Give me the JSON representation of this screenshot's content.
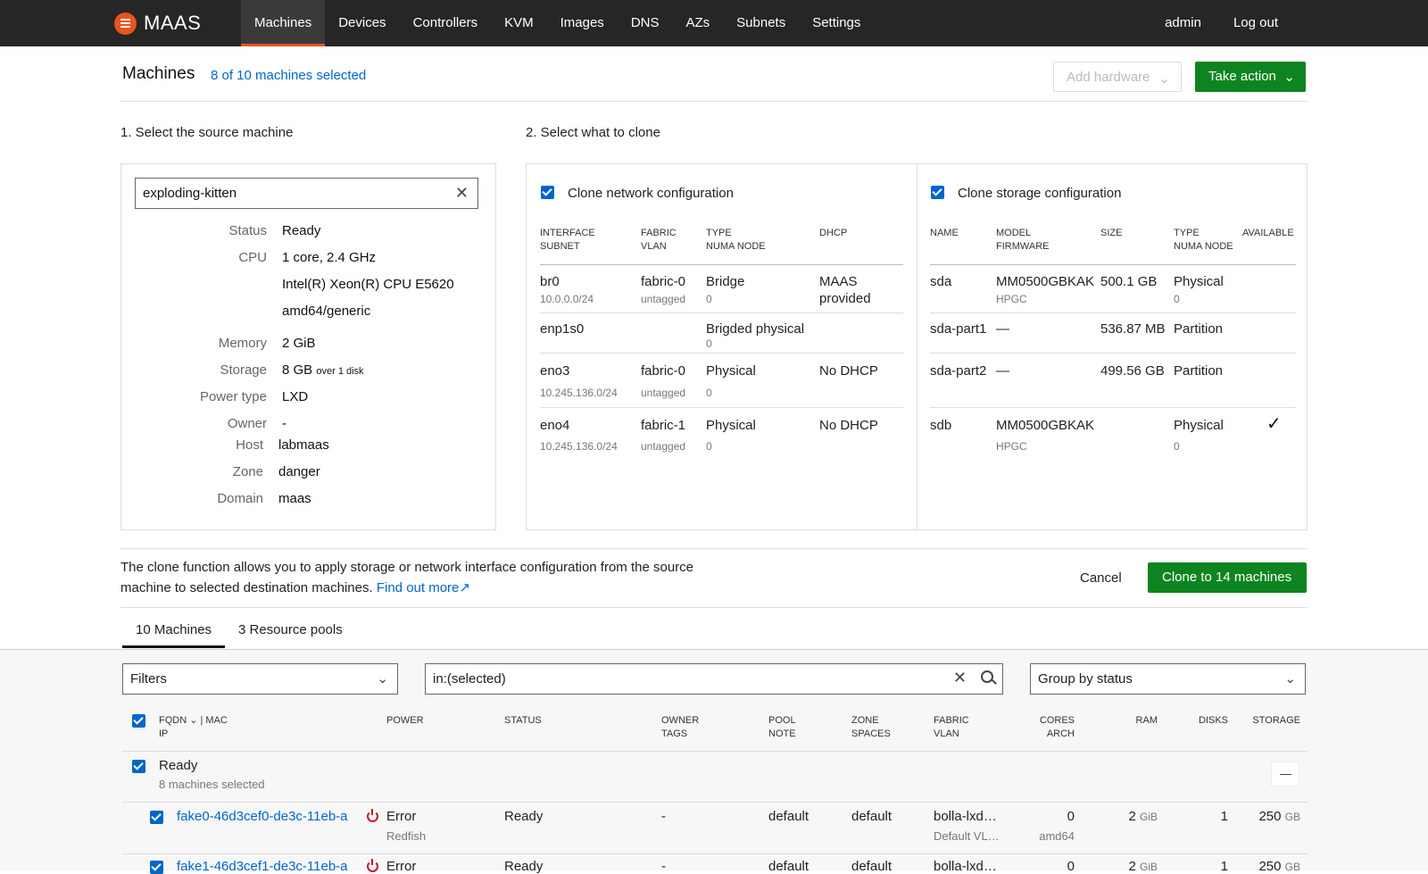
{
  "brand": {
    "name": "MAAS"
  },
  "nav": {
    "items": [
      "Machines",
      "Devices",
      "Controllers",
      "KVM",
      "Images",
      "DNS",
      "AZs",
      "Subnets",
      "Settings"
    ],
    "user": "admin",
    "logout": "Log out"
  },
  "header": {
    "title": "Machines",
    "selected": "8 of 10 machines selected",
    "add_hardware": "Add hardware",
    "take_action": "Take action"
  },
  "steps": {
    "source": "1. Select the source machine",
    "what": "2. Select what to clone"
  },
  "source": {
    "search_value": "exploding-kitten",
    "fields": [
      {
        "key": "Status",
        "value": "Ready"
      },
      {
        "key": "CPU",
        "value": "1 core, 2.4 GHz"
      },
      {
        "key": "",
        "value": "Intel(R) Xeon(R) CPU E5620"
      },
      {
        "key": "",
        "value": "amd64/generic"
      },
      {
        "key": "Memory",
        "value": "2 GiB"
      },
      {
        "key": "Storage",
        "value": "8 GB",
        "extra": "over 1 disk"
      },
      {
        "key": "Power type",
        "value": "LXD"
      },
      {
        "key": "Owner",
        "value": "-"
      },
      {
        "key": "Host",
        "value": "labmaas"
      },
      {
        "key": "Zone",
        "value": "danger"
      },
      {
        "key": "Domain",
        "value": "maas"
      }
    ]
  },
  "network": {
    "label": "Clone network configuration",
    "checked": true,
    "headers": [
      [
        "Interface",
        "Subnet"
      ],
      [
        "Fabric",
        "VLAN"
      ],
      [
        "Type",
        "NUMA node"
      ],
      [
        "DHCP",
        ""
      ]
    ],
    "rows": [
      {
        "name": "br0",
        "subnet": "10.0.0.0/24",
        "fabric": "fabric-0",
        "vlan": "untagged",
        "type": "Bridge",
        "numa": "0",
        "dhcp": "MAAS",
        "dhcp2": "provided"
      },
      {
        "name": "enp1s0",
        "subnet": "",
        "fabric": "",
        "vlan": "",
        "type": "Brigded physical",
        "numa": "0",
        "dhcp": "",
        "dhcp2": ""
      },
      {
        "name": "eno3",
        "subnet": "10.245.136.0/24",
        "fabric": "fabric-0",
        "vlan": "untagged",
        "type": "Physical",
        "numa": "0",
        "dhcp": "No DHCP",
        "dhcp2": ""
      },
      {
        "name": "eno4",
        "subnet": "10.245.136.0/24",
        "fabric": "fabric-1",
        "vlan": "untagged",
        "type": "Physical",
        "numa": "0",
        "dhcp": "No DHCP",
        "dhcp2": ""
      }
    ]
  },
  "storage": {
    "label": "Clone storage configuration",
    "checked": true,
    "headers": [
      [
        "Name",
        ""
      ],
      [
        "Model",
        "Firmware"
      ],
      [
        "Size",
        ""
      ],
      [
        "Type",
        "NUMA node"
      ],
      [
        "Available",
        ""
      ]
    ],
    "rows": [
      {
        "name": "sda",
        "model": "MM0500GBKAK",
        "firmware": "HPGC",
        "size": "500.1 GB",
        "type": "Physical",
        "numa": "0",
        "available": ""
      },
      {
        "name": "sda-part1",
        "model": "—",
        "firmware": "",
        "size": "536.87 MB",
        "type": "Partition",
        "numa": "",
        "available": ""
      },
      {
        "name": "sda-part2",
        "model": "—",
        "firmware": "",
        "size": "499.56 GB",
        "type": "Partition",
        "numa": "",
        "available": ""
      },
      {
        "name": "sdb",
        "model": "MM0500GBKAK",
        "firmware": "HPGC",
        "size": "",
        "type": "Physical",
        "numa": "0",
        "available": "✓"
      }
    ]
  },
  "info": {
    "text": "The clone function allows you to apply storage or network interface configuration from the source machine to selected destination machines.",
    "link": "Find out more",
    "cancel": "Cancel",
    "clone": "Clone to 14 machines"
  },
  "tabs": [
    "10 Machines",
    "3 Resource pools"
  ],
  "filters": {
    "filters_label": "Filters",
    "search_value": "in:(selected)",
    "group_by": "Group by status"
  },
  "machines_table": {
    "headers": {
      "fqdn": "FQDN",
      "mac": "| MAC",
      "ip": "IP",
      "power": "Power",
      "status": "Status",
      "owner": "Owner",
      "tags": "Tags",
      "pool": "Pool",
      "note": "Note",
      "zone": "Zone",
      "spaces": "Spaces",
      "fabric": "Fabric",
      "vlan": "VLAN",
      "cores": "Cores",
      "arch": "Arch",
      "ram": "RAM",
      "disks": "Disks",
      "storage": "Storage"
    },
    "group": {
      "label": "Ready",
      "sub": "8 machines selected"
    },
    "rows": [
      {
        "fqdn": "fake0-46d3cef0-de3c-11eb-a",
        "power": "Error",
        "power_sub": "Redfish",
        "status": "Ready",
        "owner": "-",
        "pool": "default",
        "zone": "default",
        "fabric": "bolla-lxd…",
        "vlan": "Default VL…",
        "cores": "0",
        "arch": "amd64",
        "ram": "2",
        "ram_unit": "GiB",
        "disks": "1",
        "storage": "250",
        "storage_unit": "GB"
      },
      {
        "fqdn": "fake1-46d3cef1-de3c-11eb-a",
        "power": "Error",
        "power_sub": "",
        "status": "Ready",
        "owner": "-",
        "pool": "default",
        "zone": "default",
        "fabric": "bolla-lxd…",
        "vlan": "",
        "cores": "0",
        "arch": "",
        "ram": "2",
        "ram_unit": "GiB",
        "disks": "1",
        "storage": "250",
        "storage_unit": "GB"
      }
    ]
  },
  "colors": {
    "accent": "#e95420",
    "link": "#0066cc",
    "positive": "#0e8420",
    "error": "#c7162b",
    "nav_bg": "#262626"
  }
}
